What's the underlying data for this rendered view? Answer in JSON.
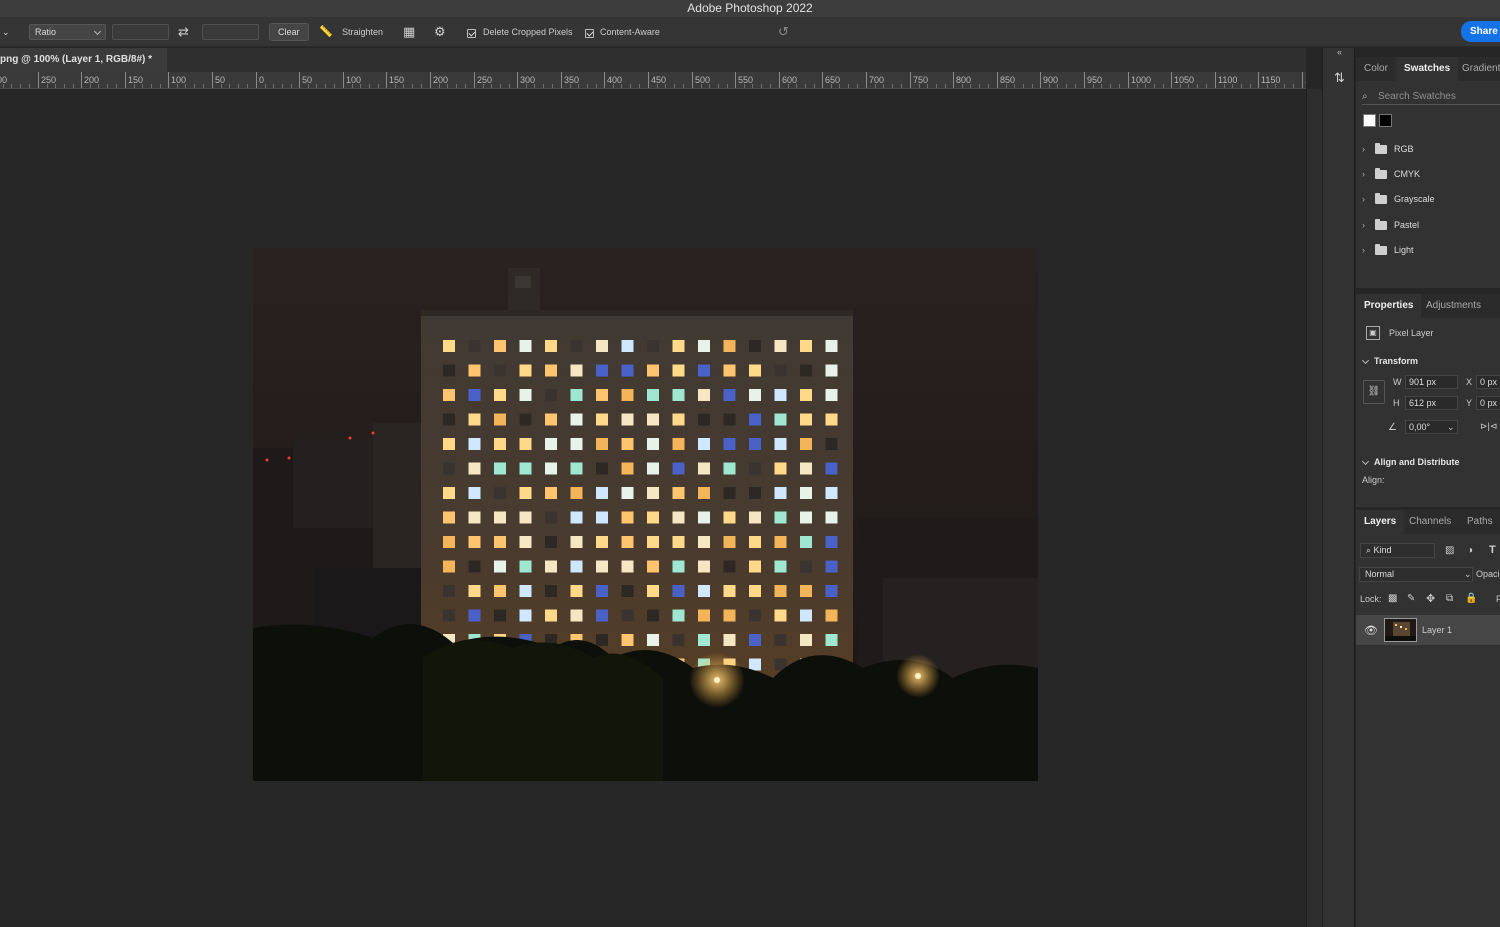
{
  "window": {
    "title": "Adobe Photoshop 2022"
  },
  "options_bar": {
    "ratio_label": "Ratio",
    "clear_label": "Clear",
    "straighten_label": "Straighten",
    "delete_cropped_label": "Delete Cropped Pixels",
    "delete_cropped_checked": true,
    "content_aware_label": "Content-Aware",
    "content_aware_checked": true,
    "share_label": "Share"
  },
  "document": {
    "tab_title": "png @ 100% (Layer 1, RGB/8#) *",
    "ruler_labels": [
      "00",
      "250",
      "200",
      "150",
      "100",
      "50",
      "0",
      "50",
      "100",
      "150",
      "200",
      "250",
      "300",
      "350",
      "400",
      "450",
      "500",
      "550",
      "600",
      "650",
      "700",
      "750",
      "800",
      "850",
      "900",
      "950",
      "1000",
      "1050",
      "1100",
      "1150",
      "12"
    ]
  },
  "swatches_panel": {
    "tabs": [
      "Color",
      "Swatches",
      "Gradient"
    ],
    "active_tab": "Swatches",
    "search_placeholder": "Search Swatches",
    "recent_colors": [
      "#ffffff",
      "#000000"
    ],
    "groups": [
      "RGB",
      "CMYK",
      "Grayscale",
      "Pastel",
      "Light"
    ]
  },
  "properties_panel": {
    "tabs": [
      "Properties",
      "Adjustments"
    ],
    "active_tab": "Properties",
    "layer_type": "Pixel Layer",
    "transform_title": "Transform",
    "w_label": "W",
    "w_value": "901 px",
    "h_label": "H",
    "h_value": "612 px",
    "x_label": "X",
    "x_value": "0 px",
    "y_label": "Y",
    "y_value": "0 px",
    "angle_value": "0,00°",
    "align_title": "Align and Distribute",
    "align_label": "Align:"
  },
  "layers_panel": {
    "tabs": [
      "Layers",
      "Channels",
      "Paths"
    ],
    "active_tab": "Layers",
    "filter_kind": "Kind",
    "blend_mode": "Normal",
    "opacity_label": "Opaci",
    "lock_label": "Lock:",
    "fill_label": "F",
    "layers": [
      {
        "name": "Layer 1",
        "visible": true
      }
    ]
  }
}
